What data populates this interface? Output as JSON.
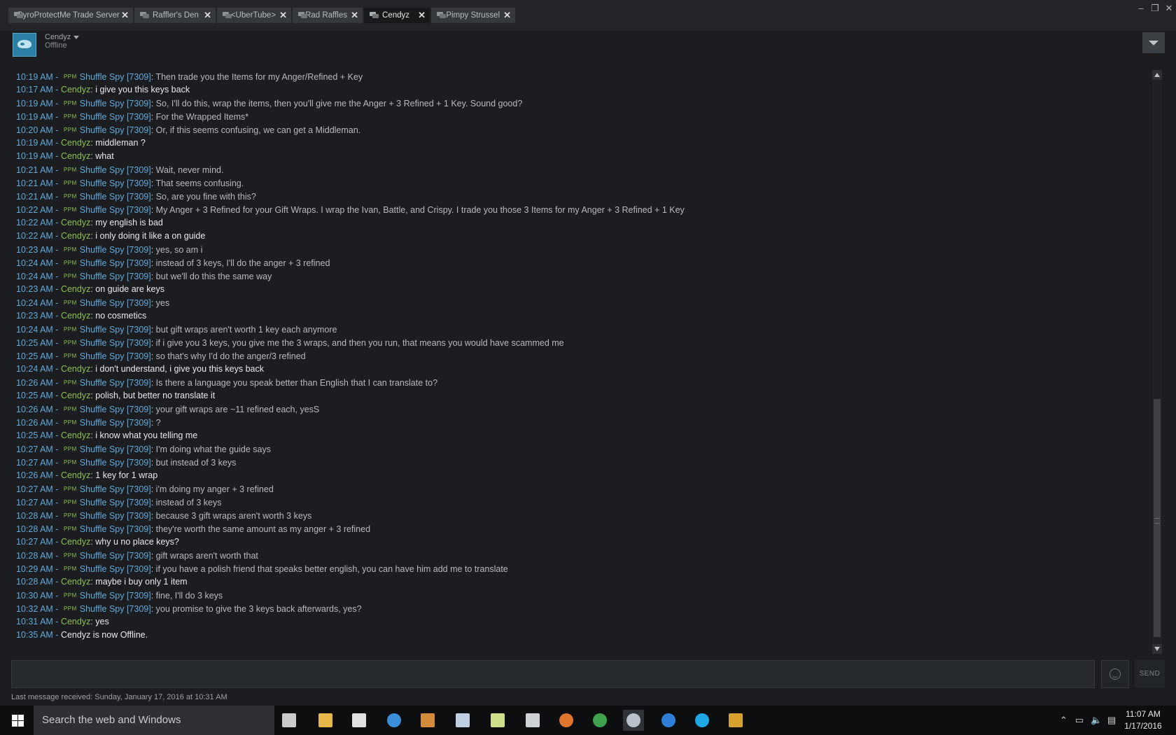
{
  "tabs": [
    {
      "label": "PyroProtectMe Trade Server",
      "active": false
    },
    {
      "label": "Raffler's Den",
      "active": false
    },
    {
      "label": "<UberTube>",
      "active": false
    },
    {
      "label": "Rad Raffles",
      "active": false
    },
    {
      "label": "Cendyz",
      "active": true
    },
    {
      "label": "Pimpy Strussel",
      "active": false
    }
  ],
  "window_controls": {
    "minimize": "–",
    "restore": "❐",
    "close": "✕"
  },
  "profile": {
    "name": "Cendyz",
    "status": "Offline"
  },
  "chat": {
    "them": "Shuffle Spy [7309]",
    "tag": "PPM",
    "me": "Cendyz",
    "messages": [
      {
        "time": "10:19 AM",
        "from": "them",
        "text": "Then trade you the Items for my Anger/Refined + Key"
      },
      {
        "time": "10:17 AM",
        "from": "me",
        "text": "i give you this keys back"
      },
      {
        "time": "10:19 AM",
        "from": "them",
        "text": "So, I'll do this, wrap the items, then you'll give me the Anger + 3 Refined + 1 Key. Sound good?"
      },
      {
        "time": "10:19 AM",
        "from": "them",
        "text": "For the Wrapped Items*"
      },
      {
        "time": "10:20 AM",
        "from": "them",
        "text": "Or, if this seems confusing, we can get a Middleman."
      },
      {
        "time": "10:19 AM",
        "from": "me",
        "text": "middleman ?"
      },
      {
        "time": "10:19 AM",
        "from": "me",
        "text": "what"
      },
      {
        "time": "10:21 AM",
        "from": "them",
        "text": "Wait, never mind."
      },
      {
        "time": "10:21 AM",
        "from": "them",
        "text": "That seems confusing."
      },
      {
        "time": "10:21 AM",
        "from": "them",
        "text": "So, are you fine with this?"
      },
      {
        "time": "10:22 AM",
        "from": "them",
        "text": "My Anger + 3 Refined for your Gift Wraps. I wrap the Ivan, Battle, and Crispy. I trade you those 3 Items for my Anger + 3 Refined + 1 Key"
      },
      {
        "time": "10:22 AM",
        "from": "me",
        "text": "my english is bad"
      },
      {
        "time": "10:22 AM",
        "from": "me",
        "text": "i only doing it like a on guide"
      },
      {
        "time": "10:23 AM",
        "from": "them",
        "text": "yes, so am i"
      },
      {
        "time": "10:24 AM",
        "from": "them",
        "text": "instead of 3 keys, I'll do the anger + 3 refined"
      },
      {
        "time": "10:24 AM",
        "from": "them",
        "text": "but we'll do this the same way"
      },
      {
        "time": "10:23 AM",
        "from": "me",
        "text": "on guide are keys"
      },
      {
        "time": "10:24 AM",
        "from": "them",
        "text": "yes"
      },
      {
        "time": "10:23 AM",
        "from": "me",
        "text": "no cosmetics"
      },
      {
        "time": "10:24 AM",
        "from": "them",
        "text": "but gift wraps aren't worth 1 key each anymore"
      },
      {
        "time": "10:25 AM",
        "from": "them",
        "text": "if i give you 3 keys, you give me the 3 wraps, and then you run, that means you would have scammed me"
      },
      {
        "time": "10:25 AM",
        "from": "them",
        "text": "so that's why I'd do the anger/3 refined"
      },
      {
        "time": "10:24 AM",
        "from": "me",
        "text": "i don't understand, i give you this keys back"
      },
      {
        "time": "10:26 AM",
        "from": "them",
        "text": "Is there a language you speak better than English that I can translate to?"
      },
      {
        "time": "10:25 AM",
        "from": "me",
        "text": "polish, but better no translate it"
      },
      {
        "time": "10:26 AM",
        "from": "them",
        "text": "your gift wraps are ~11 refined each, yesS"
      },
      {
        "time": "10:26 AM",
        "from": "them",
        "text": "?"
      },
      {
        "time": "10:25 AM",
        "from": "me",
        "text": "i know what you telling me"
      },
      {
        "time": "10:27 AM",
        "from": "them",
        "text": "I'm doing what the guide says"
      },
      {
        "time": "10:27 AM",
        "from": "them",
        "text": "but instead of 3 keys"
      },
      {
        "time": "10:26 AM",
        "from": "me",
        "text": "1 key for 1 wrap"
      },
      {
        "time": "10:27 AM",
        "from": "them",
        "text": "i'm doing my anger + 3 refined"
      },
      {
        "time": "10:27 AM",
        "from": "them",
        "text": "instead of 3 keys"
      },
      {
        "time": "10:28 AM",
        "from": "them",
        "text": "because 3 gift wraps aren't worth 3 keys"
      },
      {
        "time": "10:28 AM",
        "from": "them",
        "text": "they're worth the same amount as my anger + 3 refined"
      },
      {
        "time": "10:27 AM",
        "from": "me",
        "text": "why u no place keys?"
      },
      {
        "time": "10:28 AM",
        "from": "them",
        "text": "gift wraps aren't worth that"
      },
      {
        "time": "10:29 AM",
        "from": "them",
        "text": "if you have a polish friend that speaks better english, you can have him add me to translate"
      },
      {
        "time": "10:28 AM",
        "from": "me",
        "text": "maybe i buy only 1 item"
      },
      {
        "time": "10:30 AM",
        "from": "them",
        "text": "fine, I'll do 3 keys"
      },
      {
        "time": "10:32 AM",
        "from": "them",
        "text": "you promise to give the 3 keys back afterwards, yes?"
      },
      {
        "time": "10:31 AM",
        "from": "me",
        "text": "yes"
      },
      {
        "time": "10:35 AM",
        "from": "system",
        "text": "Cendyz is now Offline."
      }
    ]
  },
  "input": {
    "value": "",
    "send_label": "SEND"
  },
  "footer": {
    "last_message": "Last message received: Sunday, January 17, 2016 at 10:31 AM"
  },
  "taskbar": {
    "search_placeholder": "Search the web and Windows",
    "apps": [
      "task-view",
      "file-explorer",
      "store",
      "internet-explorer",
      "media-player",
      "paint",
      "file-manager",
      "calculator",
      "firefox",
      "chrome",
      "steam",
      "edge",
      "skype",
      "csgo"
    ],
    "time": "11:07 AM",
    "date": "1/17/2016"
  },
  "colors": {
    "background": "#1b1d20",
    "timestamp": "#62a9d8",
    "me": "#8fbf4f",
    "them": "#62a9d8",
    "taskbar": "#0c0e10"
  }
}
